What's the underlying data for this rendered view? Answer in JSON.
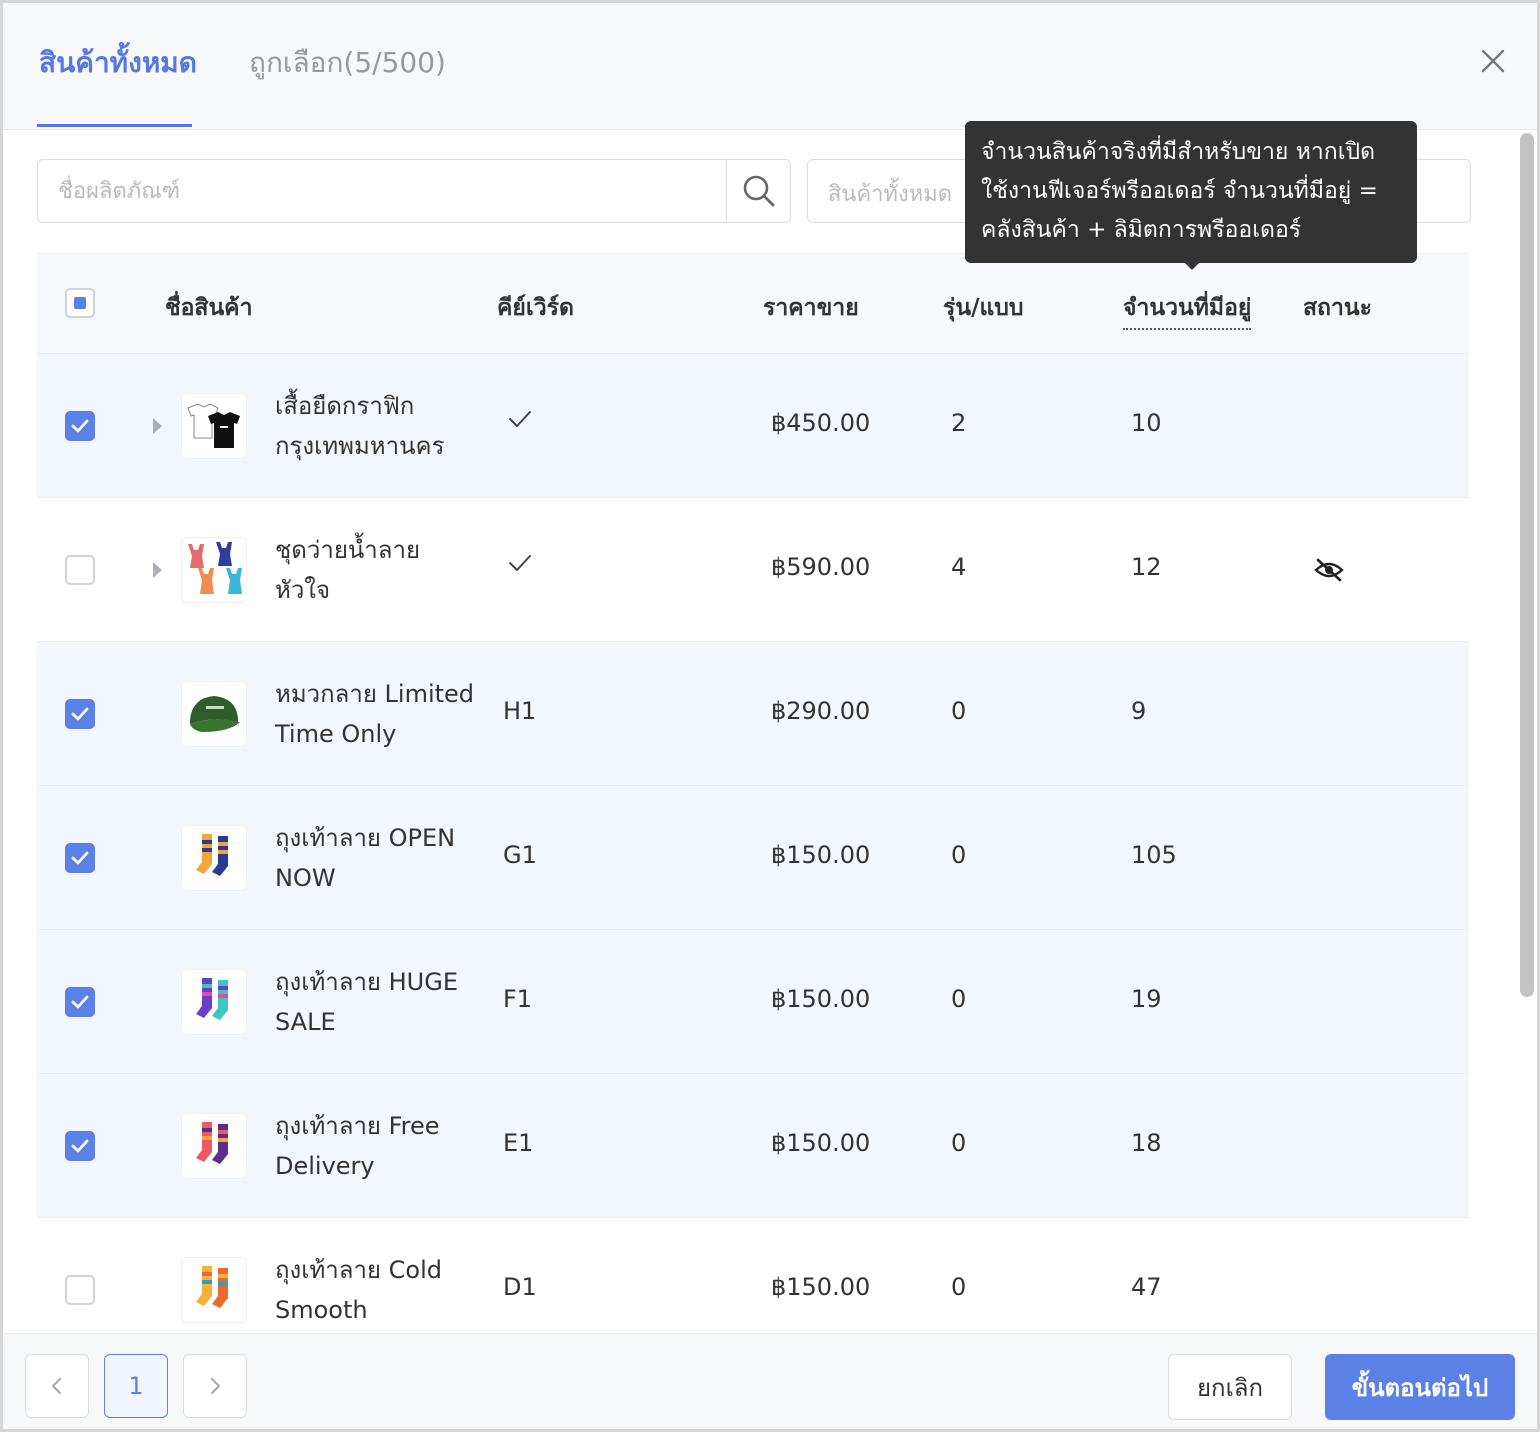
{
  "header": {
    "tab_all": "สินค้าทั้งหมด",
    "tab_selected": "ถูกเลือก(5/500)"
  },
  "search": {
    "placeholder": "ชื่อผลิตภัณฑ์",
    "filter_value": "สินค้าทั้งหมด"
  },
  "tooltip": {
    "text": "จำนวนสินค้าจริงที่มีสำหรับขาย หากเปิดใช้งานฟีเจอร์พรีออเดอร์ จำนวนที่มีอยู่ = คลังสินค้า + ลิมิตการพรีออเดอร์"
  },
  "table": {
    "headers": {
      "name": "ชื่อสินค้า",
      "keyword": "คีย์เวิร์ด",
      "price": "ราคาขาย",
      "variants": "รุ่น/แบบ",
      "available": "จำนวนที่มีอยู่",
      "status": "สถานะ"
    },
    "rows": [
      {
        "name": "เสื้อยืดกราฟิกกรุงเทพมหานคร",
        "keyword": "✓",
        "price": "฿450.00",
        "variants": "2",
        "available": "10",
        "checked": true,
        "expandable": true,
        "hidden": false,
        "thumb": "tshirt"
      },
      {
        "name": "ชุดว่ายน้ำลายหัวใจ",
        "keyword": "✓",
        "price": "฿590.00",
        "variants": "4",
        "available": "12",
        "checked": false,
        "expandable": true,
        "hidden": true,
        "thumb": "swimsuit"
      },
      {
        "name": "หมวกลาย Limited Time Only",
        "keyword": "H1",
        "price": "฿290.00",
        "variants": "0",
        "available": "9",
        "checked": true,
        "expandable": false,
        "hidden": false,
        "thumb": "cap"
      },
      {
        "name": "ถุงเท้าลาย OPEN NOW",
        "keyword": "G1",
        "price": "฿150.00",
        "variants": "0",
        "available": "105",
        "checked": true,
        "expandable": false,
        "hidden": false,
        "thumb": "socks-orange"
      },
      {
        "name": "ถุงเท้าลาย HUGE SALE",
        "keyword": "F1",
        "price": "฿150.00",
        "variants": "0",
        "available": "19",
        "checked": true,
        "expandable": false,
        "hidden": false,
        "thumb": "socks-purple"
      },
      {
        "name": "ถุงเท้าลาย Free Delivery",
        "keyword": "E1",
        "price": "฿150.00",
        "variants": "0",
        "available": "18",
        "checked": true,
        "expandable": false,
        "hidden": false,
        "thumb": "socks-pink"
      },
      {
        "name": "ถุงเท้าลาย Cold Smooth",
        "keyword": "D1",
        "price": "฿150.00",
        "variants": "0",
        "available": "47",
        "checked": false,
        "expandable": false,
        "hidden": false,
        "thumb": "socks-yellow"
      }
    ]
  },
  "pagination": {
    "current_page": "1",
    "prev_icon": "chevron-left-icon",
    "next_icon": "chevron-right-icon"
  },
  "footer": {
    "cancel_label": "ยกเลิก",
    "next_label": "ขั้นตอนต่อไป"
  },
  "colors": {
    "accent": "#5b80e6",
    "selected_row": "#f2f6fd",
    "tooltip_bg": "#333333"
  }
}
